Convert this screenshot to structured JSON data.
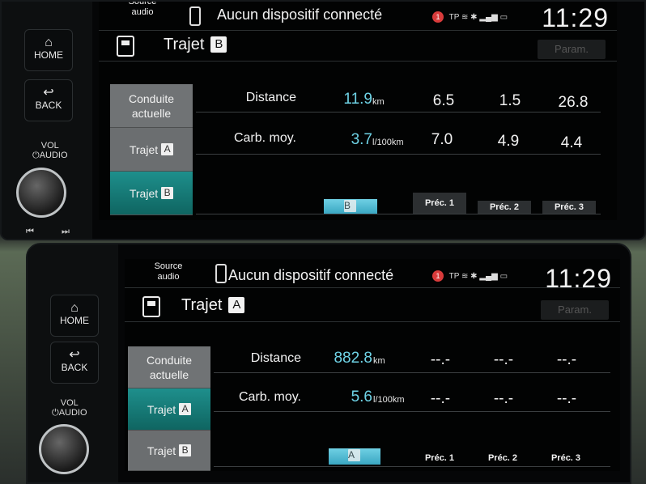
{
  "hw": {
    "home": "HOME",
    "back": "BACK",
    "vol": "VOL",
    "audio": "AUDIO",
    "prev": "⏮",
    "next": "⏭"
  },
  "panel1": {
    "source": "Source\naudio",
    "device": "Aucun dispositif connecté",
    "notif": "1",
    "tp": "TP",
    "clock": "11:29",
    "trip_label": "Trajet",
    "trip_letter": "B",
    "param": "Param.",
    "modes": [
      "Conduite\nactuelle",
      "Trajet",
      "Trajet"
    ],
    "mode_letters": [
      "",
      "A",
      "B"
    ],
    "distance_label": "Distance",
    "distance_value": "11.9",
    "distance_unit": "km",
    "fuel_label": "Carb. moy.",
    "fuel_value": "3.7",
    "fuel_unit": "l/100km",
    "history_distance": [
      "6.5",
      "1.5",
      "26.8"
    ],
    "history_fuel": [
      "7.0",
      "4.9",
      "4.4"
    ],
    "bar_letter": "B",
    "prec": [
      "Préc. 1",
      "Préc. 2",
      "Préc. 3"
    ]
  },
  "panel2": {
    "source": "Source\naudio",
    "device": "Aucun dispositif connecté",
    "notif": "1",
    "tp": "TP",
    "clock": "11:29",
    "trip_label": "Trajet",
    "trip_letter": "A",
    "param": "Param.",
    "modes": [
      "Conduite\nactuelle",
      "Trajet",
      "Trajet"
    ],
    "mode_letters": [
      "",
      "A",
      "B"
    ],
    "distance_label": "Distance",
    "distance_value": "882.8",
    "distance_unit": "km",
    "fuel_label": "Carb. moy.",
    "fuel_value": "5.6",
    "fuel_unit": "l/100km",
    "history_distance": [
      "--.-",
      "--.-",
      "--.-"
    ],
    "history_fuel": [
      "--.-",
      "--.-",
      "--.-"
    ],
    "bar_letter": "A",
    "prec": [
      "Préc. 1",
      "Préc. 2",
      "Préc. 3"
    ]
  }
}
